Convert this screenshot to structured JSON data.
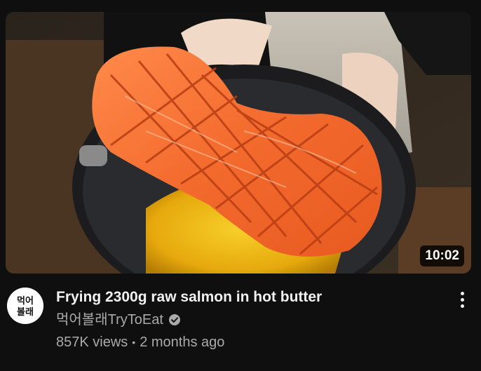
{
  "video": {
    "duration": "10:02",
    "title": "Frying 2300g raw salmon in hot butter",
    "channel": "먹어볼래TryToEat",
    "verified": true,
    "views": "857K views",
    "separator": "•",
    "age": "2 months ago"
  },
  "avatar": {
    "logo_text_line1": "먹어",
    "logo_text_line2": "볼래"
  },
  "icons": {
    "verified": "verified-check-icon",
    "more": "more-vert-icon"
  },
  "colors": {
    "background": "#0f0f0f",
    "title": "#f1f1f1",
    "secondary_text": "#aaaaaa"
  }
}
